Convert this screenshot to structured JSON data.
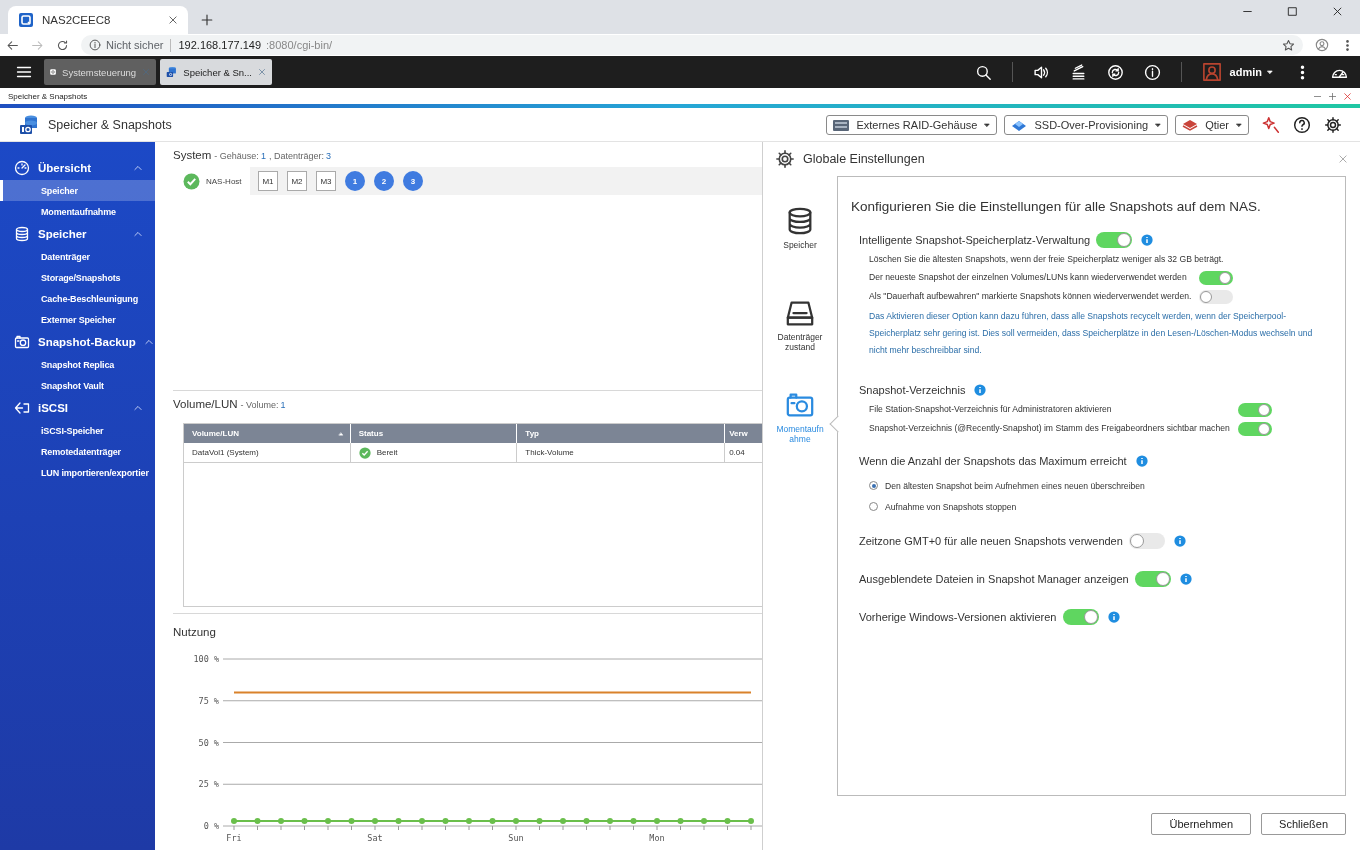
{
  "browser": {
    "tab": {
      "title": "NAS2CEEC8"
    },
    "security": "Nicht sicher",
    "url_host": "192.168.177.149",
    "url_rest": ":8080/cgi-bin/"
  },
  "topbar": {
    "apps": [
      {
        "label": "Systemsteuerung",
        "selected": false
      },
      {
        "label": "Speicher & Sn...",
        "selected": true
      }
    ],
    "user": "admin"
  },
  "window": {
    "title": "Speicher & Snapshots"
  },
  "app": {
    "title": "Speicher & Snapshots",
    "tools": [
      "Externes RAID-Gehäuse",
      "SSD-Over-Provisioning",
      "Qtier"
    ]
  },
  "sidebar": {
    "groups": [
      {
        "title": "Übersicht",
        "expanded": true,
        "items": [
          {
            "label": "Speicher",
            "selected": true
          },
          {
            "label": "Momentaufnahme",
            "selected": false
          }
        ]
      },
      {
        "title": "Speicher",
        "expanded": true,
        "items": [
          {
            "label": "Datenträger",
            "selected": false
          },
          {
            "label": "Storage/Snapshots",
            "selected": false
          },
          {
            "label": "Cache-Beschleunigung",
            "selected": false
          },
          {
            "label": "Externer Speicher",
            "selected": false
          }
        ]
      },
      {
        "title": "Snapshot-Backup",
        "expanded": true,
        "items": [
          {
            "label": "Snapshot Replica",
            "selected": false
          },
          {
            "label": "Snapshot Vault",
            "selected": false
          }
        ]
      },
      {
        "title": "iSCSI",
        "expanded": true,
        "items": [
          {
            "label": "iSCSI-Speicher",
            "selected": false
          },
          {
            "label": "Remotedatenträger",
            "selected": false
          },
          {
            "label": "LUN importieren/exportier",
            "selected": false
          }
        ]
      }
    ]
  },
  "system": {
    "title": "System",
    "summary": [
      {
        "label": "- Gehäuse:",
        "value": "1"
      },
      {
        "label": ", Datenträger:",
        "value": "3"
      }
    ],
    "host": "NAS-Host",
    "slots": [
      {
        "label": "M1",
        "kind": "slot"
      },
      {
        "label": "M2",
        "kind": "slot"
      },
      {
        "label": "M3",
        "kind": "slot"
      },
      {
        "label": "1",
        "kind": "disk"
      },
      {
        "label": "2",
        "kind": "disk"
      },
      {
        "label": "3",
        "kind": "disk"
      }
    ]
  },
  "volumes": {
    "title": "Volume/LUN",
    "summary": [
      {
        "label": "- Volume:",
        "value": "1"
      }
    ],
    "columns": [
      {
        "label": "Volume/LUN",
        "sorted": true
      },
      {
        "label": "Status",
        "sorted": false
      },
      {
        "label": "Typ",
        "sorted": false
      },
      {
        "label": "Verw",
        "sorted": false
      }
    ],
    "rows": [
      {
        "cells": [
          "DataVol1 (System)",
          "Bereit",
          "Thick-Volume",
          "0.04"
        ]
      }
    ]
  },
  "usage": {
    "title": "Nutzung",
    "chart_data": {
      "type": "line",
      "categories": [
        "Fri",
        null,
        null,
        null,
        null,
        null,
        "Sat",
        null,
        null,
        null,
        null,
        null,
        "Sun",
        null,
        null,
        null,
        null,
        null,
        "Mon",
        null,
        null,
        null,
        null
      ],
      "ylim": [
        0,
        100
      ],
      "grid": true,
      "yticks": [
        {
          "value": 0,
          "label": "0 %"
        },
        {
          "value": 25,
          "label": "25 %"
        },
        {
          "value": 50,
          "label": "50 %"
        },
        {
          "value": 75,
          "label": "75 %"
        },
        {
          "value": 100,
          "label": "100 %"
        }
      ],
      "series": [
        {
          "color": "#d9822b",
          "values": [
            80,
            80,
            80,
            80,
            80,
            80,
            80,
            80,
            80,
            80,
            80,
            80,
            80,
            80,
            80,
            80,
            80,
            80,
            80,
            80,
            80,
            80,
            80
          ]
        },
        {
          "color": "#6abf4b",
          "marker": "circle",
          "values": [
            3,
            3,
            3,
            3,
            3,
            3,
            3,
            3,
            3,
            3,
            3,
            3,
            3,
            3,
            3,
            3,
            3,
            3,
            3,
            3,
            3,
            3,
            3
          ]
        }
      ]
    }
  },
  "dialog": {
    "title": "Globale Einstellungen",
    "nav": [
      {
        "label": "Speicher",
        "selected": false
      },
      {
        "label": "Datenträger zustand",
        "selected": false
      },
      {
        "label": "Momentaufnahme",
        "selected": true
      }
    ],
    "heading": "Konfigurieren Sie die Einstellungen für alle Snapshots auf dem NAS.",
    "sections": [
      {
        "kind": "toggle",
        "label": "Intelligente Snapshot-Speicherplatz-Verwaltung",
        "on": true,
        "info": true,
        "items": [
          {
            "kind": "text",
            "text": "Löschen Sie die ältesten Snapshots, wenn der freie Speicherplatz weniger als 32 GB beträgt."
          },
          {
            "kind": "toggle",
            "label": "Der neueste Snapshot der einzelnen Volumes/LUNs kann wiederverwendet werden",
            "on": true
          },
          {
            "kind": "toggle",
            "label": "Als \"Dauerhaft aufbewahren\" markierte Snapshots können wiederverwendet werden.",
            "on": false
          },
          {
            "kind": "note",
            "text": "Das Aktivieren dieser Option kann dazu führen, dass alle Snapshots recycelt werden, wenn der Speicherpool-Speicherplatz sehr gering ist. Dies soll vermeiden, dass Speicherplätze in den Lesen-/Löschen-Modus wechseln und nicht mehr beschreibbar sind."
          }
        ]
      },
      {
        "kind": "group",
        "label": "Snapshot-Verzeichnis",
        "info": true,
        "items": [
          {
            "kind": "toggle",
            "label": "File Station-Snapshot-Verzeichnis für Administratoren aktivieren",
            "on": true
          },
          {
            "kind": "toggle",
            "label": "Snapshot-Verzeichnis (@Recently-Snapshot) im Stamm des Freigabeordners sichtbar machen",
            "on": true
          }
        ]
      },
      {
        "kind": "radio",
        "label": "Wenn die Anzahl der Snapshots das Maximum erreicht",
        "info": true,
        "options": [
          {
            "label": "Den ältesten Snapshot beim Aufnehmen eines neuen überschreiben",
            "selected": true
          },
          {
            "label": "Aufnahme von Snapshots stoppen",
            "selected": false
          }
        ]
      },
      {
        "kind": "toggle",
        "label": "Zeitzone GMT+0 für alle neuen Snapshots verwenden",
        "on": false,
        "info": true
      },
      {
        "kind": "toggle",
        "label": "Ausgeblendete Dateien in Snapshot Manager anzeigen",
        "on": true,
        "info": true
      },
      {
        "kind": "toggle",
        "label": "Vorherige Windows-Versionen aktivieren",
        "on": true,
        "info": true
      }
    ],
    "buttons": [
      "Übernehmen",
      "Schließen"
    ]
  }
}
